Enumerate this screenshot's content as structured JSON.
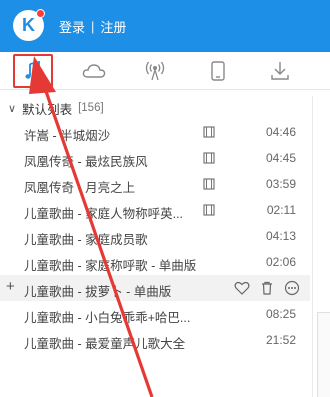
{
  "header": {
    "logo_letter": "K",
    "login_label": "登录",
    "separator": "|",
    "register_label": "注册"
  },
  "tabs": [
    {
      "icon": "music-note-icon",
      "active": true
    },
    {
      "icon": "cloud-icon",
      "active": false
    },
    {
      "icon": "radio-icon",
      "active": false
    },
    {
      "icon": "phone-icon",
      "active": false
    },
    {
      "icon": "download-icon",
      "active": false
    }
  ],
  "playlist": {
    "name": "默认列表",
    "count": "[156]"
  },
  "songs": [
    {
      "title": "许嵩 - 半城烟沙",
      "duration": "04:46",
      "mv": true
    },
    {
      "title": "凤凰传奇 - 最炫民族风",
      "duration": "04:45",
      "mv": true
    },
    {
      "title": "凤凰传奇 - 月亮之上",
      "duration": "03:59",
      "mv": true
    },
    {
      "title": "儿童歌曲 - 家庭人物称呼英...",
      "duration": "02:11",
      "mv": true
    },
    {
      "title": "儿童歌曲 - 家庭成员歌",
      "duration": "04:13",
      "mv": false
    },
    {
      "title": "儿童歌曲 - 家庭称呼歌 - 单曲版",
      "duration": "02:06",
      "mv": false
    },
    {
      "title": "儿童歌曲 - 拔萝卜 - 单曲版",
      "duration": "",
      "mv": false,
      "hover": true
    },
    {
      "title": "儿童歌曲 - 小白兔乖乖+哈巴...",
      "duration": "08:25",
      "mv": false
    },
    {
      "title": "儿童歌曲 - 最爱童声儿歌大全",
      "duration": "21:52",
      "mv": false
    }
  ],
  "colors": {
    "header_bg": "#1e8fe6",
    "annotation_red": "#e53935"
  }
}
